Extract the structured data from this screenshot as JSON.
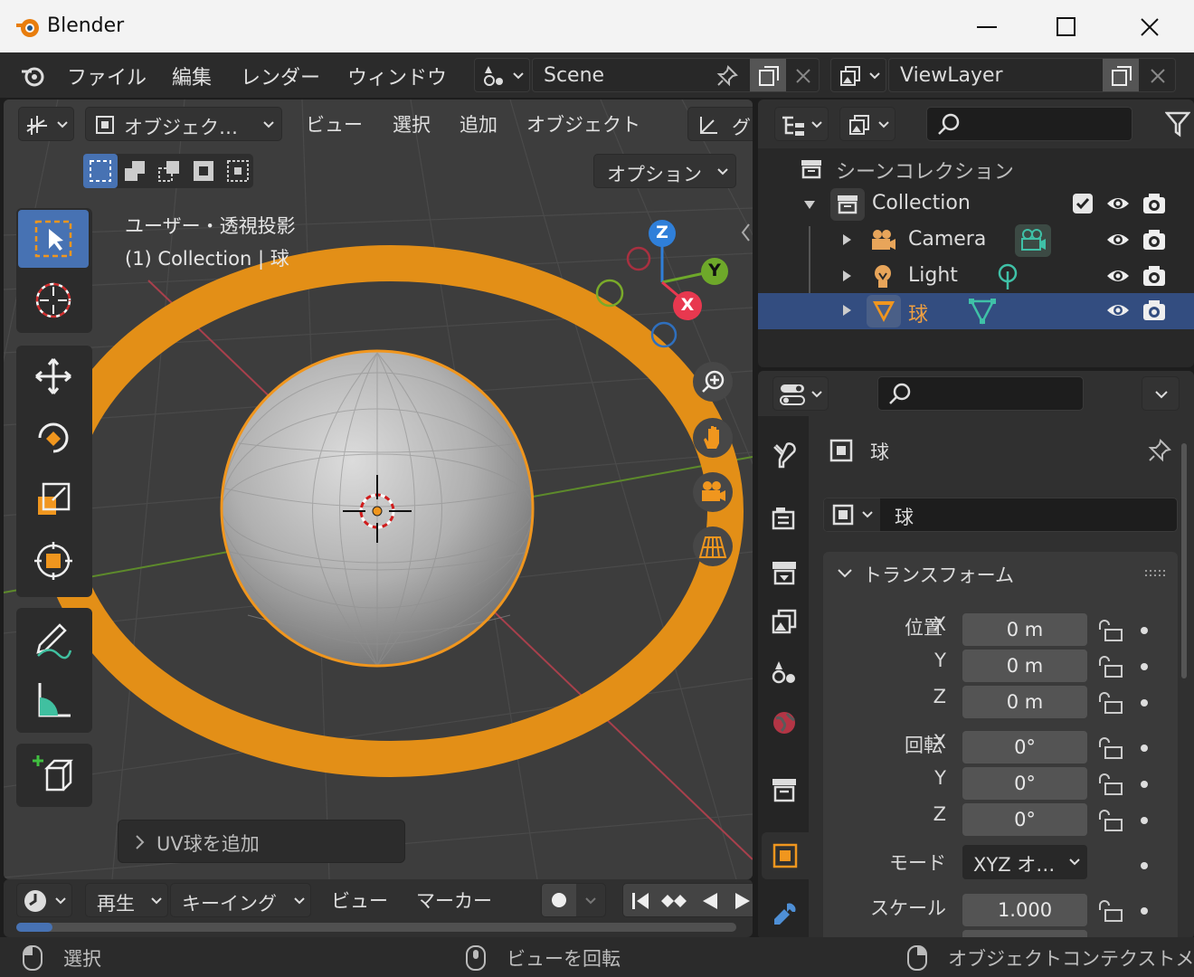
{
  "window": {
    "title": "Blender"
  },
  "menu": {
    "items": [
      "ファイル",
      "編集",
      "レンダー",
      "ウィンドウ"
    ]
  },
  "scene": {
    "name": "Scene"
  },
  "viewlayer": {
    "name": "ViewLayer"
  },
  "viewport_header": {
    "mode_label": "オブジェク…",
    "menus": [
      "ビュー",
      "選択",
      "追加",
      "オブジェクト"
    ],
    "extra": "グ",
    "options_label": "オプション"
  },
  "viewport": {
    "view_name": "ユーザー・透視投影",
    "view_info": "(1) Collection | 球",
    "last_op": "UV球を追加",
    "gizmo": {
      "x": "X",
      "y": "Y",
      "z": "Z"
    }
  },
  "outliner": {
    "root": "シーンコレクション",
    "collection": "Collection",
    "items": [
      {
        "name": "Camera"
      },
      {
        "name": "Light"
      },
      {
        "name": "球"
      }
    ]
  },
  "properties": {
    "object_name_header": "球",
    "object_name_field": "球",
    "panel_title": "トランスフォーム",
    "location_label": "位置",
    "rotation_label": "回転",
    "mode_label": "モード",
    "scale_label": "スケール",
    "axis": {
      "x": "X",
      "y": "Y",
      "z": "Z"
    },
    "location": [
      "0 m",
      "0 m",
      "0 m"
    ],
    "rotation": [
      "0°",
      "0°",
      "0°"
    ],
    "rotation_mode": "XYZ オ…",
    "scale_x": "1.000"
  },
  "timeline": {
    "playback": "再生",
    "keying": "キーイング",
    "view": "ビュー",
    "marker": "マーカー"
  },
  "status": {
    "left": "選択",
    "middle": "ビューを回転",
    "right": "オブジェクトコンテクストメ"
  },
  "colors": {
    "accent": "#4772b3",
    "selection": "#f0961e",
    "x_axis": "#e8384f",
    "y_axis": "#6ea82a",
    "z_axis": "#2f7fd9"
  }
}
